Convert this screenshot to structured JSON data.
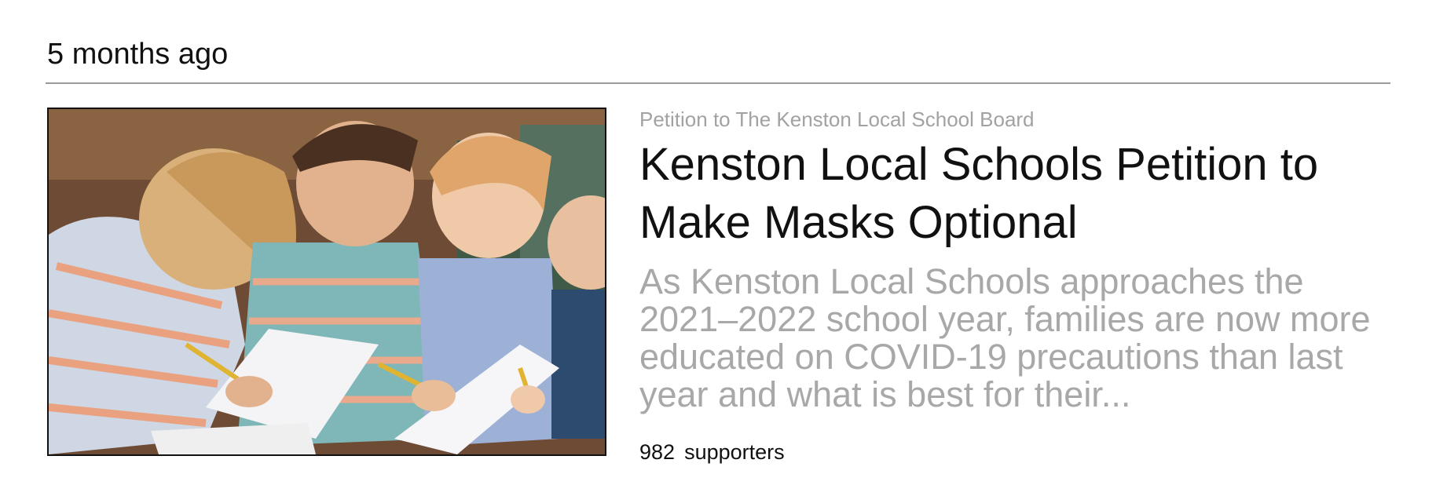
{
  "timestamp": "5 months ago",
  "petition": {
    "recipient_line": "Petition to The Kenston Local School Board",
    "title": "Kenston Local Schools Petition to Make Masks Optional",
    "description": "As Kenston Local Schools approaches the 2021–2022 school year, families are now more educated on COVID-19 precautions than last year and what is best for their...",
    "supporter_count": "982",
    "supporter_label": "supporters",
    "image_icon": "children-writing-photo"
  },
  "colors": {
    "primary_text": "#111111",
    "muted_text": "#a2a2a2",
    "divider": "#9a9a9a"
  }
}
